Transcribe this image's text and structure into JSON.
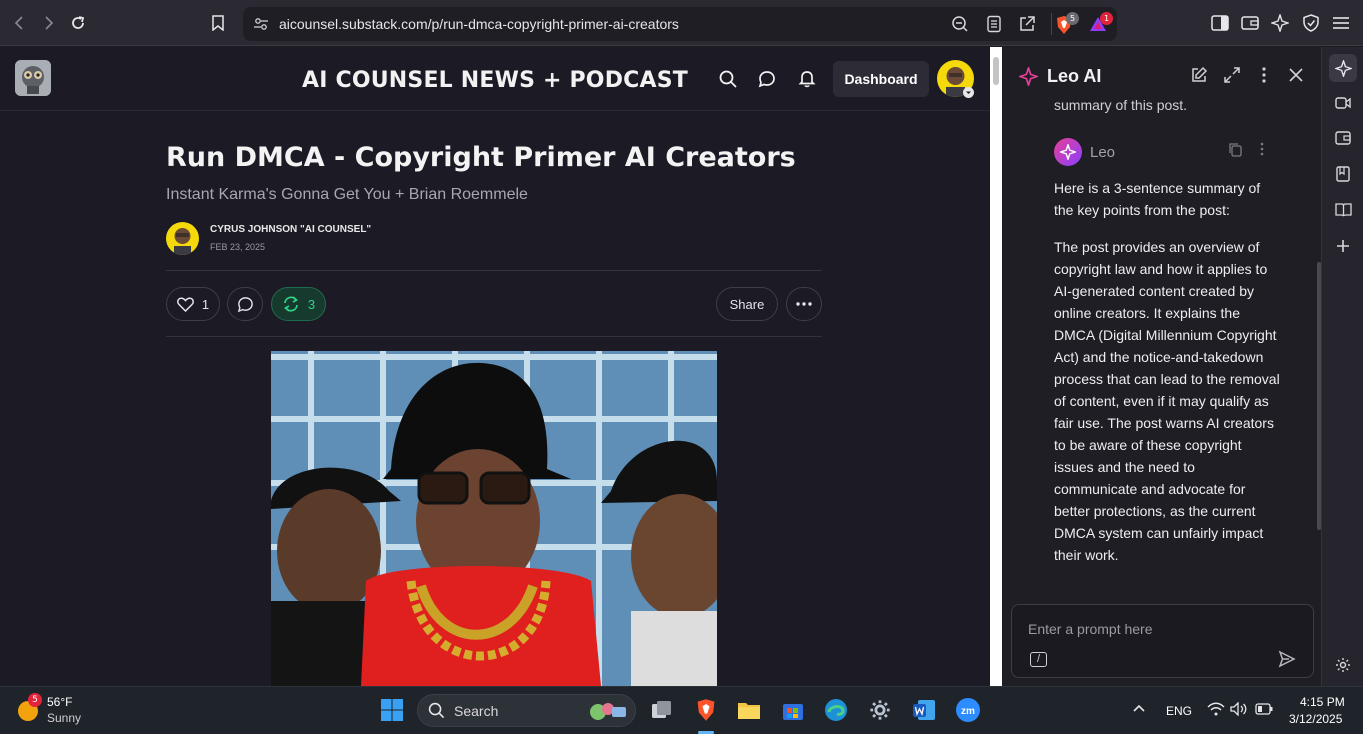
{
  "browser": {
    "url": "aicounsel.substack.com/p/run-dmca-copyright-primer-ai-creators",
    "shields_count": "5",
    "rewards_count": "1"
  },
  "site": {
    "title": "AI COUNSEL NEWS + PODCAST",
    "dashboard_label": "Dashboard"
  },
  "post": {
    "title": "Run DMCA - Copyright Primer AI Creators",
    "subtitle": "Instant Karma's Gonna Get You + Brian Roemmele",
    "author": "CYRUS JOHNSON \"AI COUNSEL\"",
    "date": "FEB 23, 2025",
    "likes": "1",
    "restacks": "3",
    "share_label": "Share"
  },
  "leo": {
    "title": "Leo AI",
    "prev_message_tail": "summary of this post.",
    "sender": "Leo",
    "response": [
      "Here is a 3-sentence summary of the key points from the post:",
      "The post provides an overview of copyright law and how it applies to AI-generated content created by online creators. It explains the DMCA (Digital Millennium Copyright Act) and the notice-and-takedown process that can lead to the removal of content, even if it may qualify as fair use. The post warns AI creators to be aware of these copyright issues and the need to communicate and advocate for better protections, as the current DMCA system can unfairly impact their work."
    ],
    "prompt_placeholder": "Enter a prompt here",
    "slash_label": "/"
  },
  "taskbar": {
    "weather_temp": "56°F",
    "weather_desc": "Sunny",
    "weather_badge": "5",
    "search_label": "Search",
    "language": "ENG",
    "time": "4:15 PM",
    "date": "3/12/2025"
  },
  "colors": {
    "accent_green": "#2fd38a",
    "leo_pink": "#e63f9a",
    "brave_orange": "#fb542b"
  }
}
